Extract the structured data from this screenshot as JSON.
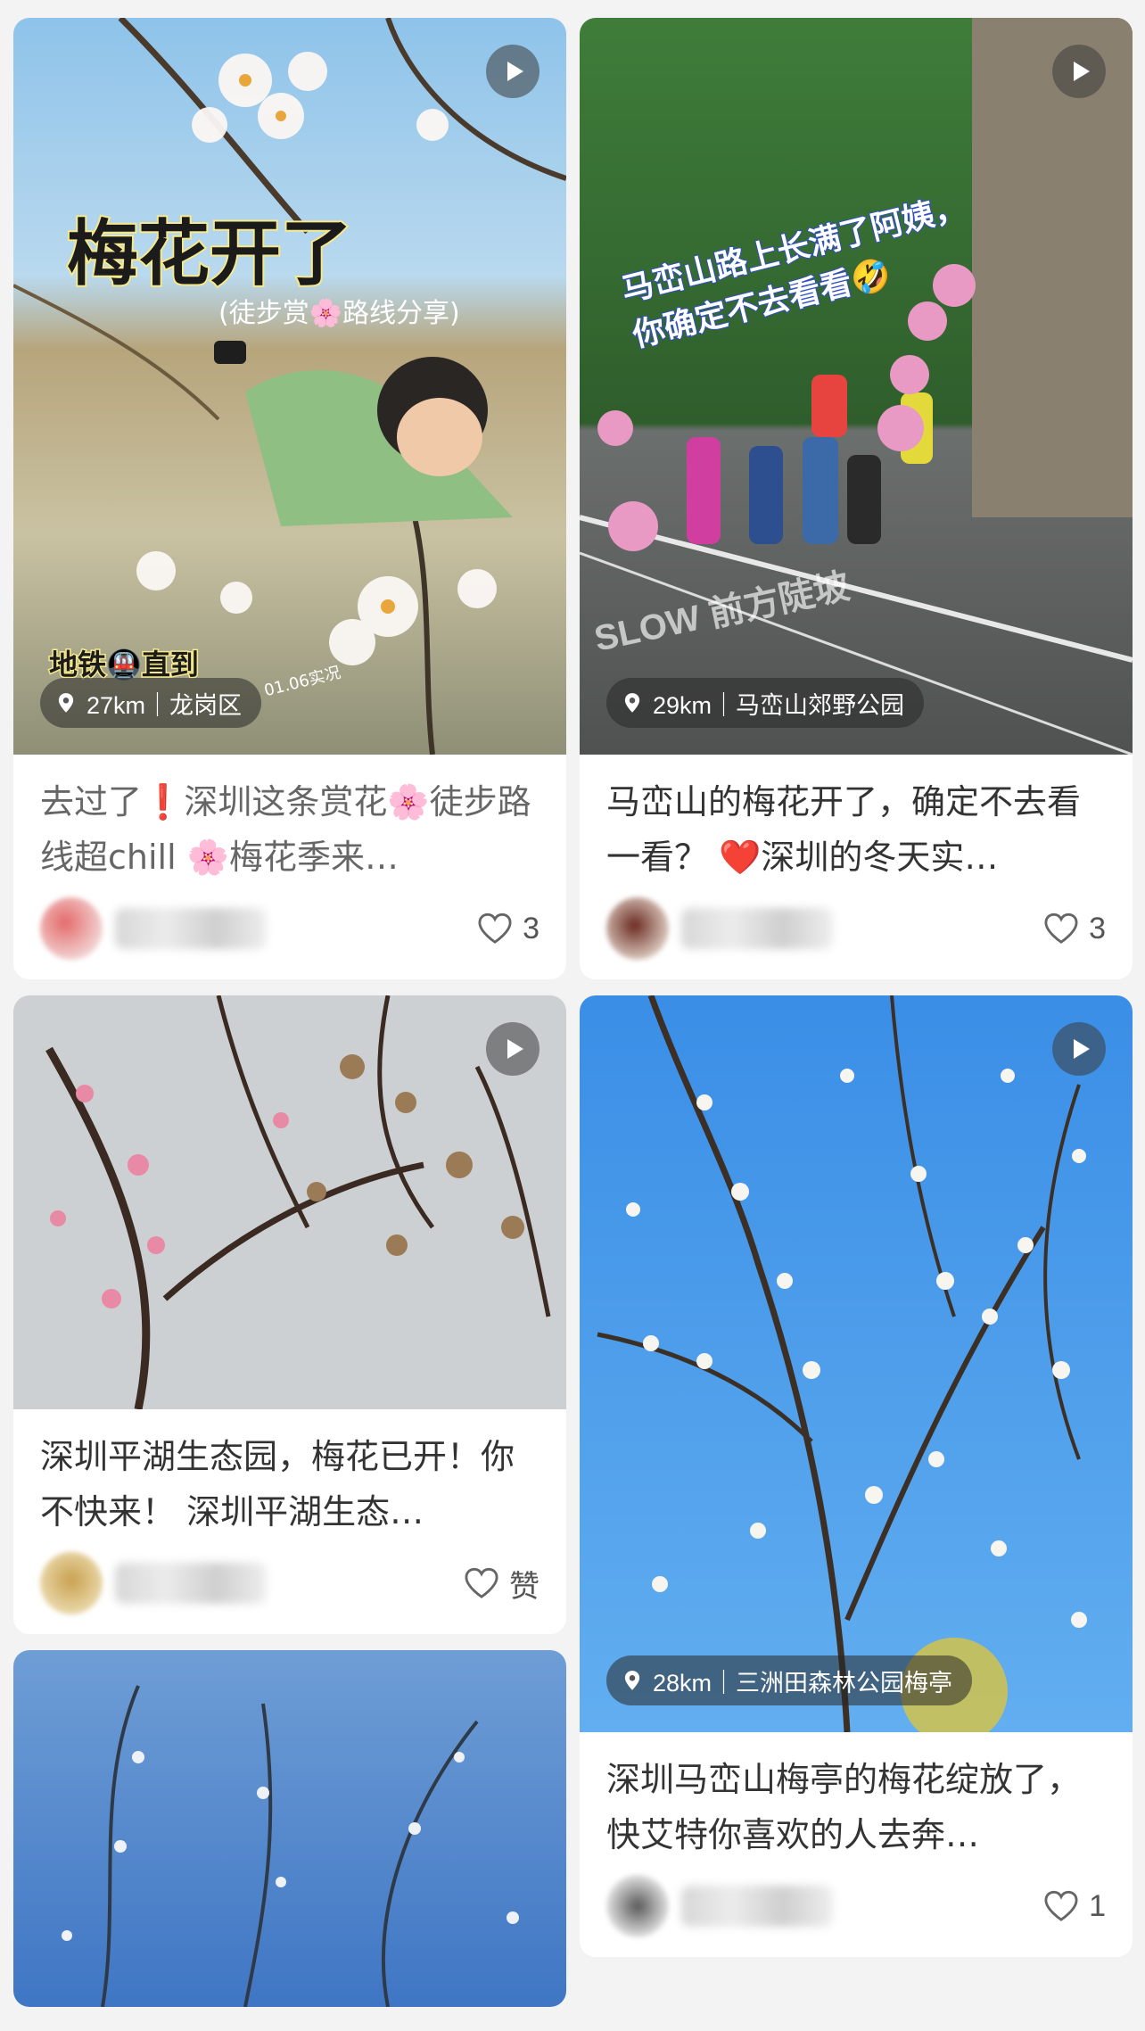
{
  "feed": {
    "left": [
      {
        "overlay_title": "梅花开了",
        "overlay_sub": "(徒步赏🌸路线分享)",
        "overlay_tag": "地铁🚇直到",
        "overlay_tag2": "01.06实况",
        "has_video": true,
        "location": "27km｜龙岗区",
        "title": "去过了❗深圳这条赏花🌸徒步路线超chill 🌸梅花季来…",
        "author": "蛤派",
        "likes": "3"
      },
      {
        "has_video": true,
        "title": "深圳平湖生态园，梅花已开！你不快来！ 深圳平湖生态…",
        "author": "大友",
        "likes": "赞"
      },
      {
        "title": ""
      }
    ],
    "right": [
      {
        "overlay_title": "马峦山路上长满了阿姨，你确定不去看看🤣",
        "overlay_sign": "SLOW 前方陡坡",
        "has_video": true,
        "location": "29km｜马峦山郊野公园",
        "title": "马峦山的梅花开了，确定不去看一看？ ❤️深圳的冬天实…",
        "author": "",
        "likes": "3"
      },
      {
        "has_video": true,
        "location": "28km｜三洲田森林公园梅亭",
        "title": "深圳马峦山梅亭的梅花绽放了，快艾特你喜欢的人去奔…",
        "author": "",
        "likes": "1"
      }
    ]
  },
  "icons": {
    "play": "play-icon",
    "location": "location-pin-icon",
    "like": "heart-outline-icon"
  }
}
